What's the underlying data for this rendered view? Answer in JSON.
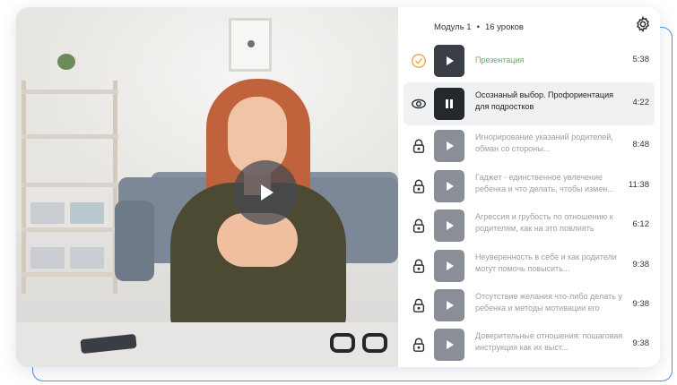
{
  "module": {
    "label": "Модуль 1",
    "separator": "•",
    "lessons_count": "16 уроков"
  },
  "colors": {
    "accent_green": "#4db86a",
    "check_orange": "#f0a64a",
    "frame_blue": "#4a90e2"
  },
  "lessons": [
    {
      "title": "Презентация",
      "duration": "5:38",
      "status": "completed",
      "status_icon": "check-circle-icon"
    },
    {
      "title": "Осознаный выбор. Профориентация для подростков",
      "duration": "4:22",
      "status": "playing",
      "status_icon": "eye-icon"
    },
    {
      "title": "Игнорирование указаний родителей, обман со стороны...",
      "duration": "8:48",
      "status": "locked",
      "status_icon": "lock-icon"
    },
    {
      "title": "Гаджет - единственное увлечение ребенка и что делать, чтобы измен...",
      "duration": "11:38",
      "status": "locked",
      "status_icon": "lock-icon"
    },
    {
      "title": "Агрессия и грубость по отношению к родителям, как на это повлиять",
      "duration": "6:12",
      "status": "locked",
      "status_icon": "lock-icon"
    },
    {
      "title": "Неуверенность в себе и как родители могут помочь повысить...",
      "duration": "9:38",
      "status": "locked",
      "status_icon": "lock-icon"
    },
    {
      "title": "Отсутствие желания что-либо делать у ребенка и методы мотивации его",
      "duration": "9:38",
      "status": "locked",
      "status_icon": "lock-icon"
    },
    {
      "title": "Доверительные отношения: пошаговая инструкция как их выст...",
      "duration": "9:38",
      "status": "locked",
      "status_icon": "lock-icon"
    }
  ]
}
